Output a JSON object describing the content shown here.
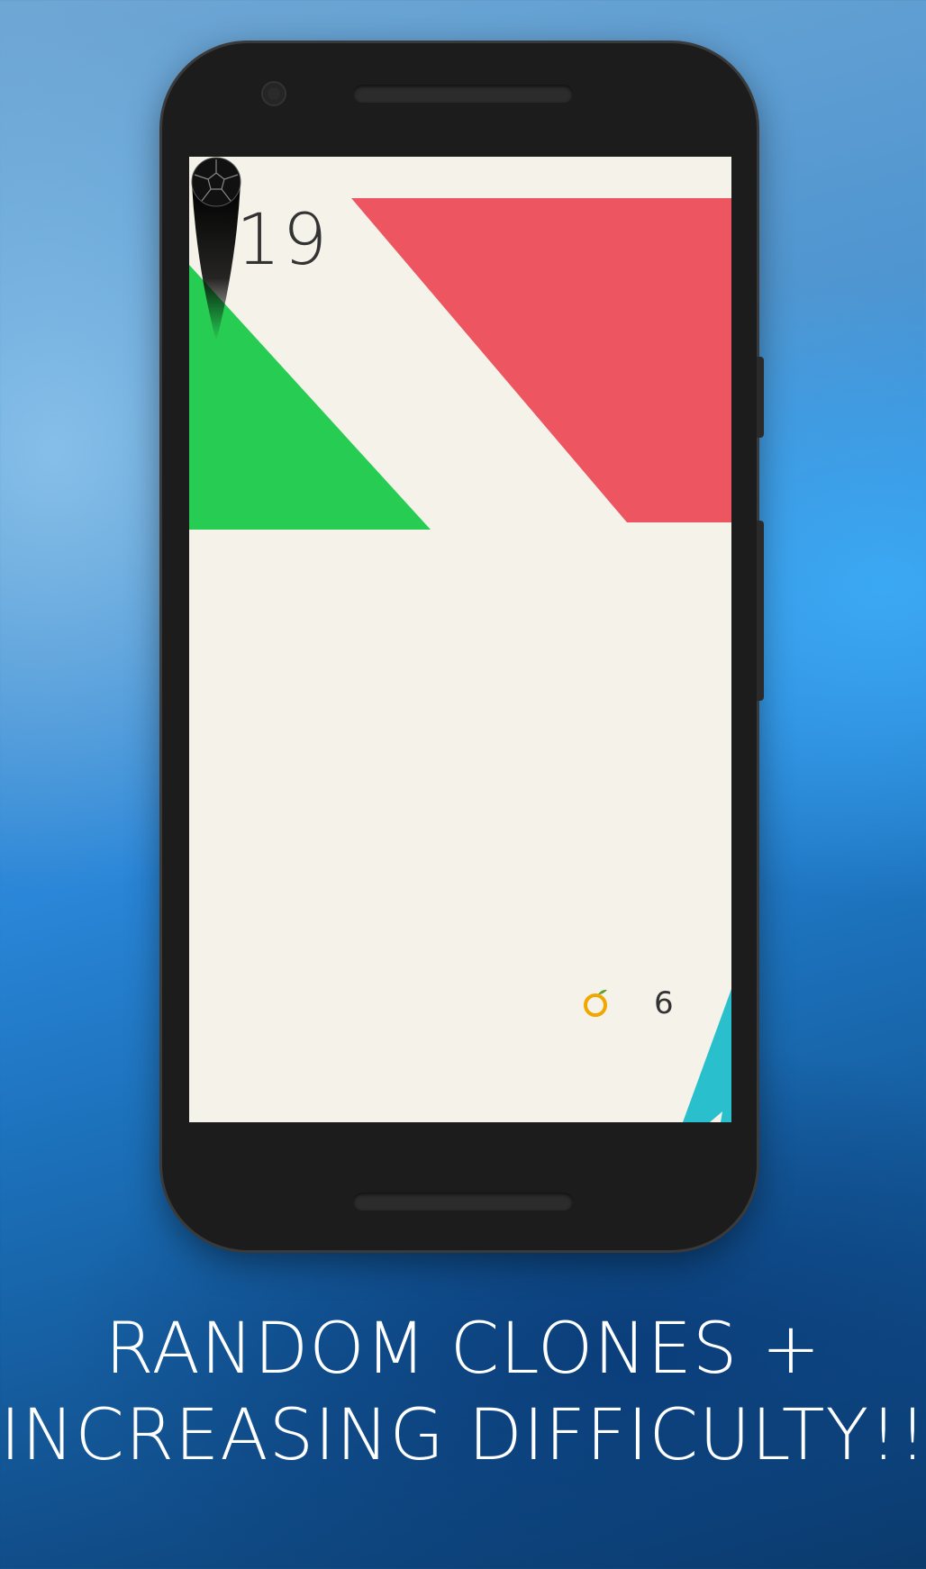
{
  "game": {
    "score": "19",
    "coins": "6"
  },
  "caption": {
    "line1": "RANDOM CLONES +",
    "line2": "INCREASING DIFFICULTY!!"
  },
  "colors": {
    "screen_bg": "#f5f2e9",
    "red_obstacle": "#ed5560",
    "green_obstacle": "#27cc53",
    "cyan_obstacle": "#29bfcd",
    "ball": "#111111",
    "coin": "#f0a800"
  },
  "icons": {
    "coin": "coin-icon",
    "ball": "soccer-ball-icon"
  }
}
